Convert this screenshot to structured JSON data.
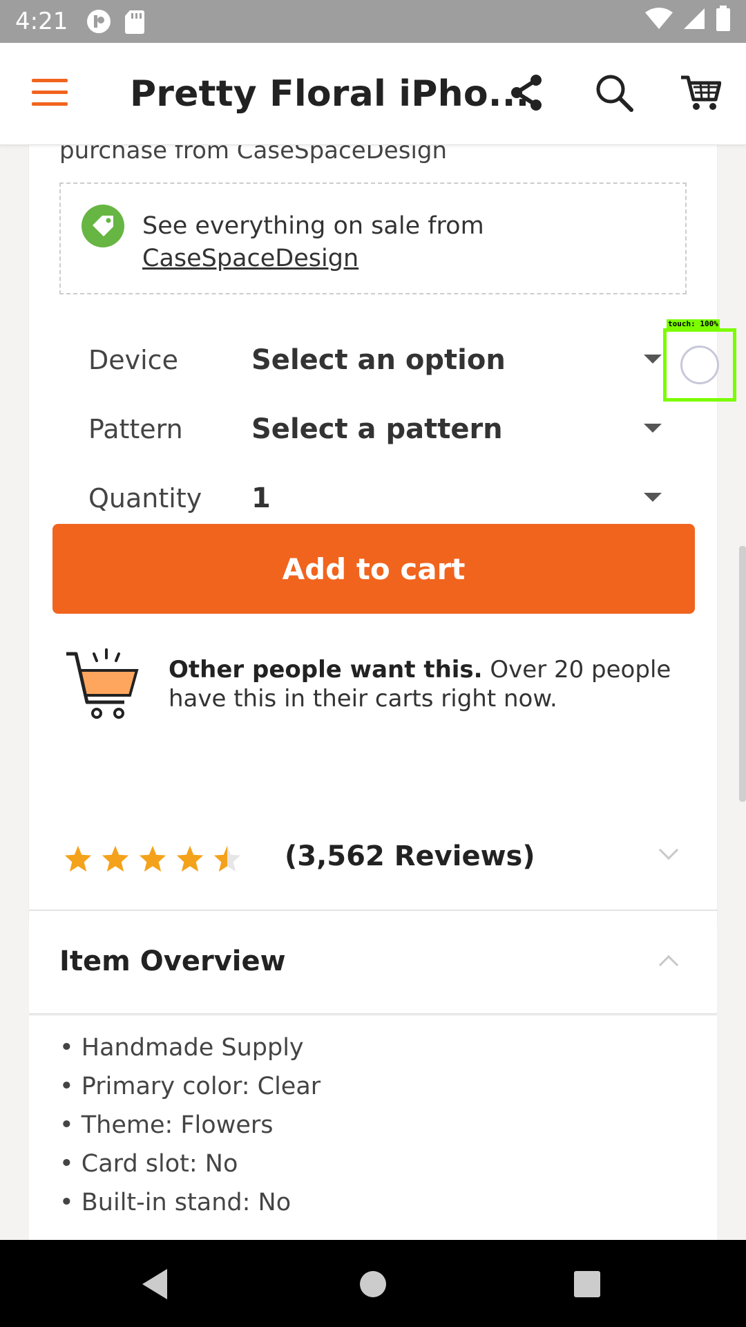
{
  "status_bar": {
    "time": "4:21"
  },
  "app_bar": {
    "title": "Pretty Floral iPho..."
  },
  "shop": {
    "purchase_text": "purchase from CaseSpaceDesign",
    "sale_text": "See everything on sale from",
    "sale_link": "CaseSpaceDesign"
  },
  "options": [
    {
      "label": "Device",
      "value": "Select an option"
    },
    {
      "label": "Pattern",
      "value": "Select a pattern"
    },
    {
      "label": "Quantity",
      "value": "1"
    }
  ],
  "touch_label": "touch: 100%",
  "add_to_cart_label": "Add to cart",
  "demand": {
    "strong": "Other people want this.",
    "rest": " Over 20 people have this in their carts right now."
  },
  "reviews": {
    "rating": 4.5,
    "count_text": "(3,562 Reviews)"
  },
  "overview": {
    "title": "Item Overview",
    "items": [
      "Handmade Supply",
      "Primary color: Clear",
      "Theme: Flowers",
      "Card slot: No",
      "Built-in stand: No"
    ]
  },
  "icons": {
    "menu": "menu-icon",
    "share": "share-icon",
    "search": "search-icon",
    "cart": "cart-icon",
    "tag": "tag-icon",
    "demand_cart": "shopping-cart-icon",
    "star": "star-icon",
    "back": "back-icon",
    "home": "home-icon",
    "recents": "recents-icon"
  },
  "colors": {
    "accent": "#f1641e",
    "star": "#f4a21b",
    "tag_green": "#67b543",
    "touch": "#7cfc00"
  }
}
